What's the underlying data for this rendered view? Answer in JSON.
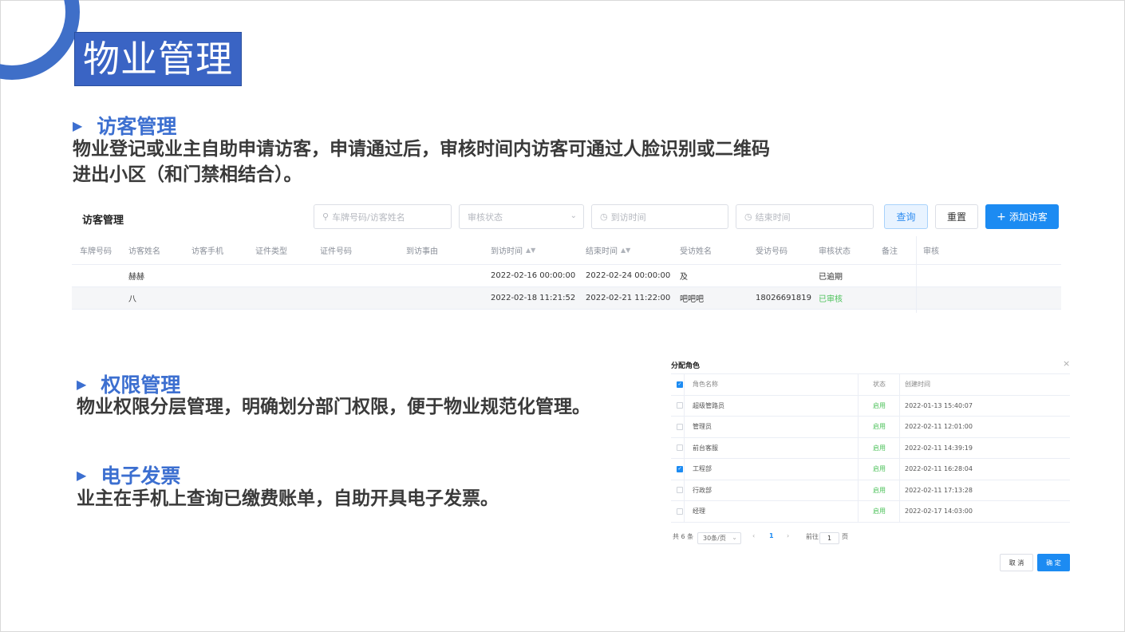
{
  "slide": {
    "title": "物业管理",
    "sections": [
      {
        "heading": "访客管理",
        "text_lines": [
          "物业登记或业主自助申请访客，申请通过后，审核时间内访客可通过人脸识别或二维码",
          "进出小区（和门禁相结合）。"
        ]
      },
      {
        "heading": "权限管理",
        "text_lines": [
          "物业权限分层管理，明确划分部门权限，便于物业规范化管理。"
        ]
      },
      {
        "heading": "电子发票",
        "text_lines": [
          "业主在手机上查询已缴费账单，自助开具电子发票。"
        ]
      }
    ],
    "bullet_glyph": "▶"
  },
  "visitor": {
    "panel_title": "访客管理",
    "search_placeholder": "车牌号码/访客姓名",
    "status_placeholder": "审核状态",
    "visit_time_placeholder": "到访时间",
    "end_time_placeholder": "结束时间",
    "query_label": "查询",
    "reset_label": "重置",
    "add_label": "添加访客",
    "columns": [
      "车牌号码",
      "访客姓名",
      "访客手机",
      "证件类型",
      "证件号码",
      "到访事由",
      "到访时间",
      "结束时间",
      "受访姓名",
      "受访号码",
      "审核状态",
      "备注",
      "审核"
    ],
    "rows": [
      [
        "",
        "赫赫",
        "",
        "",
        "",
        "",
        "2022-02-16 00:00:00",
        "2022-02-24 00:00:00",
        "及",
        "",
        "已逾期",
        "",
        ""
      ],
      [
        "",
        "八",
        "",
        "",
        "",
        "",
        "2022-02-18 11:21:52",
        "2022-02-21 11:22:00",
        "吧吧吧",
        "18026691819",
        "已审核",
        "",
        ""
      ]
    ],
    "status_colors": {
      "已审核": "#4cc25a",
      "已逾期": "#333333"
    }
  },
  "role_dialog": {
    "title": "分配角色",
    "close_glyph": "×",
    "columns": [
      "角色名称",
      "状态",
      "创建时间"
    ],
    "header_checked": true,
    "rows": [
      {
        "checked": false,
        "name": "超级管路员",
        "status": "启用",
        "created": "2022-01-13 15:40:07"
      },
      {
        "checked": false,
        "name": "管理员",
        "status": "启用",
        "created": "2022-02-11 12:01:00"
      },
      {
        "checked": false,
        "name": "前台客服",
        "status": "启用",
        "created": "2022-02-11 14:39:19"
      },
      {
        "checked": true,
        "name": "工程部",
        "status": "启用",
        "created": "2022-02-11 16:28:04"
      },
      {
        "checked": false,
        "name": "行政部",
        "status": "启用",
        "created": "2022-02-11 17:13:28"
      },
      {
        "checked": false,
        "name": "经理",
        "status": "启用",
        "created": "2022-02-17 14:03:00"
      }
    ],
    "pager": {
      "total": "共 6 条",
      "page_size": "30条/页",
      "prev": "‹",
      "current": "1",
      "next": "›",
      "goto_prefix": "前往",
      "goto_value": "1",
      "goto_suffix": "页"
    },
    "cancel_label": "取 消",
    "ok_label": "确 定"
  },
  "colors": {
    "accent": "#1c8bf2",
    "heading_blue": "#3c6fd0",
    "title_bg": "#3a64c4",
    "enabled_green": "#4cc25a"
  }
}
